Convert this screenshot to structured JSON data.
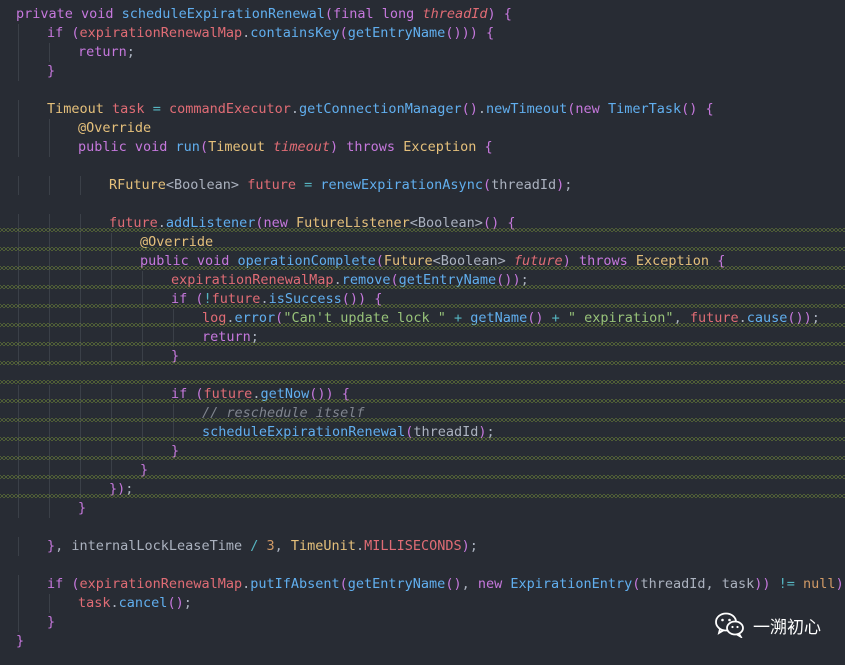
{
  "editor": {
    "lines": [
      {
        "indent": 0,
        "squiggle": false,
        "tokens": [
          [
            "kw",
            "private "
          ],
          [
            "kw",
            "void "
          ],
          [
            "fn",
            "scheduleExpirationRenewal"
          ],
          [
            "paren",
            "("
          ],
          [
            "kw",
            "final "
          ],
          [
            "kw",
            "long "
          ],
          [
            "par",
            "threadId"
          ],
          [
            "paren",
            ")"
          ],
          [
            "pl",
            " "
          ],
          [
            "brace",
            "{"
          ]
        ]
      },
      {
        "indent": 1,
        "squiggle": false,
        "tokens": [
          [
            "kw",
            "if "
          ],
          [
            "paren",
            "("
          ],
          [
            "var",
            "expirationRenewalMap"
          ],
          [
            "pl",
            "."
          ],
          [
            "fn",
            "containsKey"
          ],
          [
            "paren",
            "("
          ],
          [
            "fn",
            "getEntryName"
          ],
          [
            "paren",
            "()"
          ],
          [
            "paren",
            "))"
          ],
          [
            "pl",
            " "
          ],
          [
            "brace",
            "{"
          ]
        ]
      },
      {
        "indent": 2,
        "squiggle": false,
        "tokens": [
          [
            "kw",
            "return"
          ],
          [
            "pl",
            ";"
          ]
        ]
      },
      {
        "indent": 1,
        "squiggle": false,
        "tokens": [
          [
            "brace",
            "}"
          ]
        ]
      },
      {
        "indent": 0,
        "squiggle": false,
        "tokens": []
      },
      {
        "indent": 1,
        "squiggle": false,
        "tokens": [
          [
            "ty",
            "Timeout "
          ],
          [
            "var",
            "task"
          ],
          [
            "pl",
            " "
          ],
          [
            "op",
            "="
          ],
          [
            "pl",
            " "
          ],
          [
            "var",
            "commandExecutor"
          ],
          [
            "pl",
            "."
          ],
          [
            "fn",
            "getConnectionManager"
          ],
          [
            "paren",
            "()"
          ],
          [
            "pl",
            "."
          ],
          [
            "fn",
            "newTimeout"
          ],
          [
            "paren",
            "("
          ],
          [
            "kw",
            "new "
          ],
          [
            "fn",
            "TimerTask"
          ],
          [
            "paren",
            "()"
          ],
          [
            "pl",
            " "
          ],
          [
            "brace",
            "{"
          ]
        ]
      },
      {
        "indent": 2,
        "squiggle": false,
        "tokens": [
          [
            "ann",
            "@Override"
          ]
        ]
      },
      {
        "indent": 2,
        "squiggle": false,
        "tokens": [
          [
            "kw",
            "public "
          ],
          [
            "kw",
            "void "
          ],
          [
            "fn",
            "run"
          ],
          [
            "paren",
            "("
          ],
          [
            "ty",
            "Timeout "
          ],
          [
            "par",
            "timeout"
          ],
          [
            "paren",
            ")"
          ],
          [
            "pl",
            " "
          ],
          [
            "kw",
            "throws "
          ],
          [
            "ty",
            "Exception"
          ],
          [
            "pl",
            " "
          ],
          [
            "brace",
            "{"
          ]
        ]
      },
      {
        "indent": 0,
        "squiggle": false,
        "tokens": []
      },
      {
        "indent": 3,
        "squiggle": false,
        "tokens": [
          [
            "ty",
            "RFuture"
          ],
          [
            "pl",
            "<Boolean> "
          ],
          [
            "var",
            "future"
          ],
          [
            "pl",
            " "
          ],
          [
            "op",
            "="
          ],
          [
            "pl",
            " "
          ],
          [
            "fn",
            "renewExpirationAsync"
          ],
          [
            "paren",
            "("
          ],
          [
            "pl",
            "threadId"
          ],
          [
            "paren",
            ")"
          ],
          [
            "pl",
            ";"
          ]
        ]
      },
      {
        "indent": 0,
        "squiggle": false,
        "tokens": []
      },
      {
        "indent": 3,
        "squiggle": true,
        "tokens": [
          [
            "var",
            "future"
          ],
          [
            "pl",
            "."
          ],
          [
            "fn",
            "addListener"
          ],
          [
            "paren",
            "("
          ],
          [
            "kw",
            "new "
          ],
          [
            "ty",
            "FutureListener"
          ],
          [
            "pl",
            "<Boolean>"
          ],
          [
            "paren",
            "()"
          ],
          [
            "pl",
            " "
          ],
          [
            "brace",
            "{"
          ]
        ]
      },
      {
        "indent": 4,
        "squiggle": true,
        "tokens": [
          [
            "ann",
            "@Override"
          ]
        ]
      },
      {
        "indent": 4,
        "squiggle": true,
        "tokens": [
          [
            "kw",
            "public "
          ],
          [
            "kw",
            "void "
          ],
          [
            "fn",
            "operationComplete"
          ],
          [
            "paren",
            "("
          ],
          [
            "ty",
            "Future"
          ],
          [
            "pl",
            "<Boolean> "
          ],
          [
            "par",
            "future"
          ],
          [
            "paren",
            ")"
          ],
          [
            "pl",
            " "
          ],
          [
            "kw",
            "throws "
          ],
          [
            "ty",
            "Exception"
          ],
          [
            "pl",
            " "
          ],
          [
            "brace",
            "{"
          ]
        ]
      },
      {
        "indent": 5,
        "squiggle": true,
        "tokens": [
          [
            "var",
            "expirationRenewalMap"
          ],
          [
            "pl",
            "."
          ],
          [
            "fn",
            "remove"
          ],
          [
            "paren",
            "("
          ],
          [
            "fn",
            "getEntryName"
          ],
          [
            "paren",
            "()"
          ],
          [
            "paren",
            ")"
          ],
          [
            "pl",
            ";"
          ]
        ]
      },
      {
        "indent": 5,
        "squiggle": true,
        "tokens": [
          [
            "kw",
            "if "
          ],
          [
            "paren",
            "("
          ],
          [
            "op",
            "!"
          ],
          [
            "var",
            "future"
          ],
          [
            "pl",
            "."
          ],
          [
            "fn",
            "isSuccess"
          ],
          [
            "paren",
            "()"
          ],
          [
            "paren",
            ")"
          ],
          [
            "pl",
            " "
          ],
          [
            "brace",
            "{"
          ]
        ]
      },
      {
        "indent": 6,
        "squiggle": true,
        "tokens": [
          [
            "var",
            "log"
          ],
          [
            "pl",
            "."
          ],
          [
            "fn",
            "error"
          ],
          [
            "paren",
            "("
          ],
          [
            "str",
            "\"Can't update lock \""
          ],
          [
            "pl",
            " "
          ],
          [
            "op",
            "+"
          ],
          [
            "pl",
            " "
          ],
          [
            "fn",
            "getName"
          ],
          [
            "paren",
            "()"
          ],
          [
            "pl",
            " "
          ],
          [
            "op",
            "+"
          ],
          [
            "pl",
            " "
          ],
          [
            "str",
            "\" expiration\""
          ],
          [
            "pl",
            ", "
          ],
          [
            "var",
            "future"
          ],
          [
            "pl",
            "."
          ],
          [
            "fn",
            "cause"
          ],
          [
            "paren",
            "()"
          ],
          [
            "paren",
            ")"
          ],
          [
            "pl",
            ";"
          ]
        ]
      },
      {
        "indent": 6,
        "squiggle": true,
        "tokens": [
          [
            "kw",
            "return"
          ],
          [
            "pl",
            ";"
          ]
        ]
      },
      {
        "indent": 5,
        "squiggle": true,
        "tokens": [
          [
            "brace",
            "}"
          ]
        ]
      },
      {
        "indent": 0,
        "squiggle": true,
        "tokens": []
      },
      {
        "indent": 5,
        "squiggle": true,
        "tokens": [
          [
            "kw",
            "if "
          ],
          [
            "paren",
            "("
          ],
          [
            "var",
            "future"
          ],
          [
            "pl",
            "."
          ],
          [
            "fn",
            "getNow"
          ],
          [
            "paren",
            "()"
          ],
          [
            "paren",
            ")"
          ],
          [
            "pl",
            " "
          ],
          [
            "brace",
            "{"
          ]
        ]
      },
      {
        "indent": 6,
        "squiggle": true,
        "tokens": [
          [
            "cmt",
            "// reschedule itself"
          ]
        ]
      },
      {
        "indent": 6,
        "squiggle": true,
        "tokens": [
          [
            "fn",
            "scheduleExpirationRenewal"
          ],
          [
            "paren",
            "("
          ],
          [
            "pl",
            "threadId"
          ],
          [
            "paren",
            ")"
          ],
          [
            "pl",
            ";"
          ]
        ]
      },
      {
        "indent": 5,
        "squiggle": true,
        "tokens": [
          [
            "brace",
            "}"
          ]
        ]
      },
      {
        "indent": 4,
        "squiggle": true,
        "tokens": [
          [
            "brace",
            "}"
          ]
        ]
      },
      {
        "indent": 3,
        "squiggle": true,
        "tokens": [
          [
            "brace",
            "}"
          ],
          [
            "paren",
            ")"
          ],
          [
            "pl",
            ";"
          ]
        ]
      },
      {
        "indent": 2,
        "squiggle": false,
        "tokens": [
          [
            "brace",
            "}"
          ]
        ]
      },
      {
        "indent": 0,
        "squiggle": false,
        "tokens": []
      },
      {
        "indent": 1,
        "squiggle": false,
        "tokens": [
          [
            "brace",
            "}"
          ],
          [
            "pl",
            ", internalLockLeaseTime "
          ],
          [
            "op",
            "/"
          ],
          [
            "pl",
            " "
          ],
          [
            "num",
            "3"
          ],
          [
            "pl",
            ", "
          ],
          [
            "ty",
            "TimeUnit"
          ],
          [
            "pl",
            "."
          ],
          [
            "var",
            "MILLISECONDS"
          ],
          [
            "paren",
            ")"
          ],
          [
            "pl",
            ";"
          ]
        ]
      },
      {
        "indent": 0,
        "squiggle": false,
        "tokens": []
      },
      {
        "indent": 1,
        "squiggle": false,
        "tokens": [
          [
            "kw",
            "if "
          ],
          [
            "paren",
            "("
          ],
          [
            "var",
            "expirationRenewalMap"
          ],
          [
            "pl",
            "."
          ],
          [
            "fn",
            "putIfAbsent"
          ],
          [
            "paren",
            "("
          ],
          [
            "fn",
            "getEntryName"
          ],
          [
            "paren",
            "()"
          ],
          [
            "pl",
            ", "
          ],
          [
            "kw",
            "new "
          ],
          [
            "fn",
            "ExpirationEntry"
          ],
          [
            "paren",
            "("
          ],
          [
            "pl",
            "threadId, task"
          ],
          [
            "paren",
            "))"
          ],
          [
            "pl",
            " "
          ],
          [
            "op",
            "!="
          ],
          [
            "pl",
            " "
          ],
          [
            "num",
            "null"
          ],
          [
            "paren",
            ")"
          ],
          [
            "pl",
            " "
          ],
          [
            "brace",
            "{"
          ]
        ]
      },
      {
        "indent": 2,
        "squiggle": false,
        "tokens": [
          [
            "var",
            "task"
          ],
          [
            "pl",
            "."
          ],
          [
            "fn",
            "cancel"
          ],
          [
            "paren",
            "()"
          ],
          [
            "pl",
            ";"
          ]
        ]
      },
      {
        "indent": 1,
        "squiggle": false,
        "tokens": [
          [
            "brace",
            "}"
          ]
        ]
      },
      {
        "indent": 0,
        "squiggle": false,
        "tokens": [
          [
            "brace",
            "}"
          ]
        ]
      }
    ]
  },
  "watermark": {
    "text": "一溯初心",
    "icon": "wechat-icon"
  },
  "colors": {
    "background": "#282c34",
    "keyword": "#c678dd",
    "function": "#61afef",
    "type": "#e5c07b",
    "variable": "#e06c75",
    "string": "#98c379",
    "comment": "#7f848e",
    "squiggle": "#7f9a3a"
  }
}
